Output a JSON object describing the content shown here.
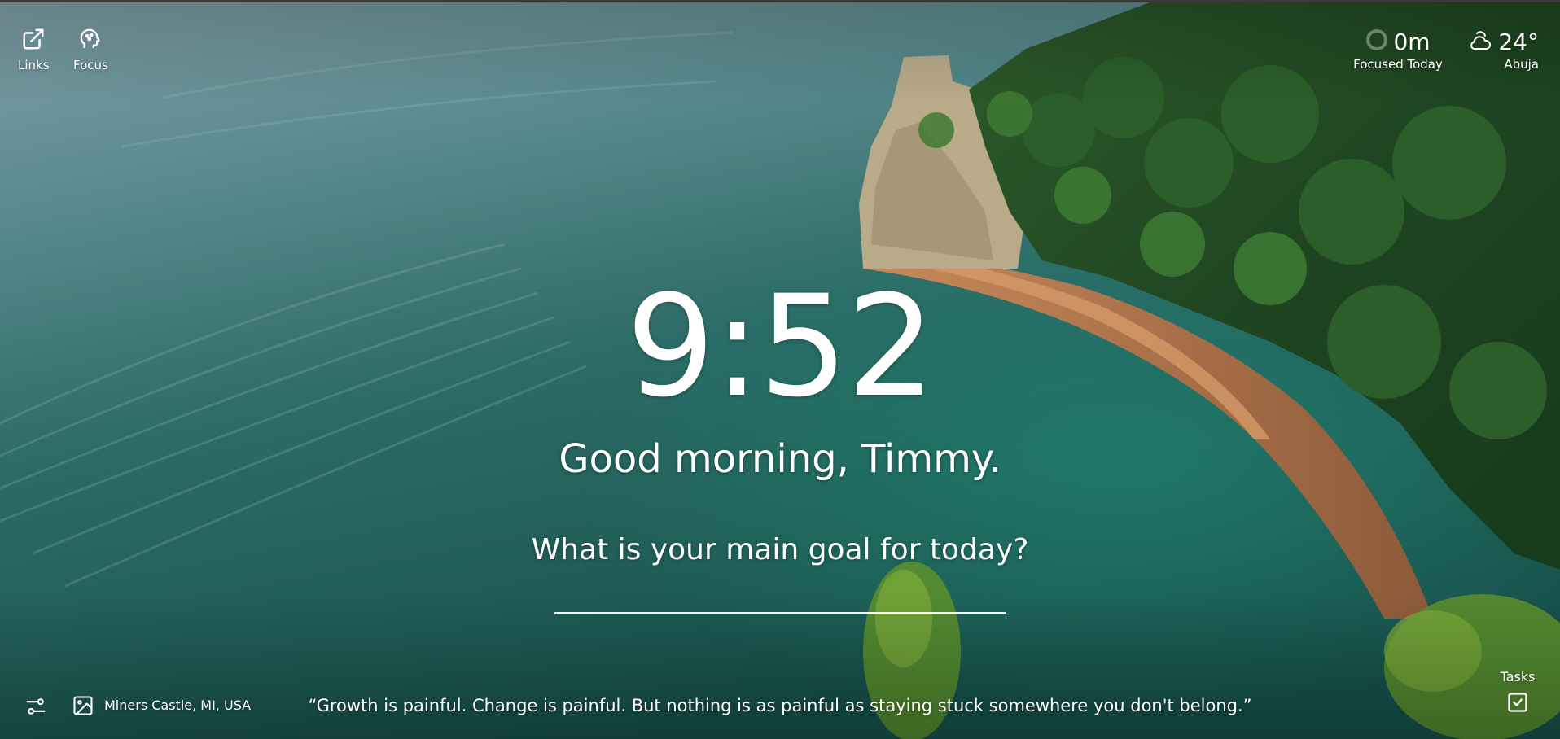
{
  "nav": {
    "links_label": "Links",
    "focus_label": "Focus"
  },
  "focus_widget": {
    "value": "0m",
    "label": "Focused Today"
  },
  "weather": {
    "temperature": "24°",
    "city": "Abuja",
    "icon": "partly-cloudy-icon"
  },
  "clock": {
    "time": "9:52"
  },
  "greeting": {
    "text": "Good morning, Timmy."
  },
  "goal": {
    "question": "What is your main goal for today?",
    "value": ""
  },
  "photo": {
    "location": "Miners Castle, MI, USA"
  },
  "quote": {
    "text": "“Growth is painful. Change is painful. But nothing is as painful as staying stuck somewhere you don't belong.”"
  },
  "tasks": {
    "label": "Tasks"
  },
  "colors": {
    "text": "#ffffff",
    "water_deep": "#1f5f5a",
    "water_light": "#6e9aa0",
    "forest": "#1f4a24",
    "cliff": "#b4734a"
  }
}
